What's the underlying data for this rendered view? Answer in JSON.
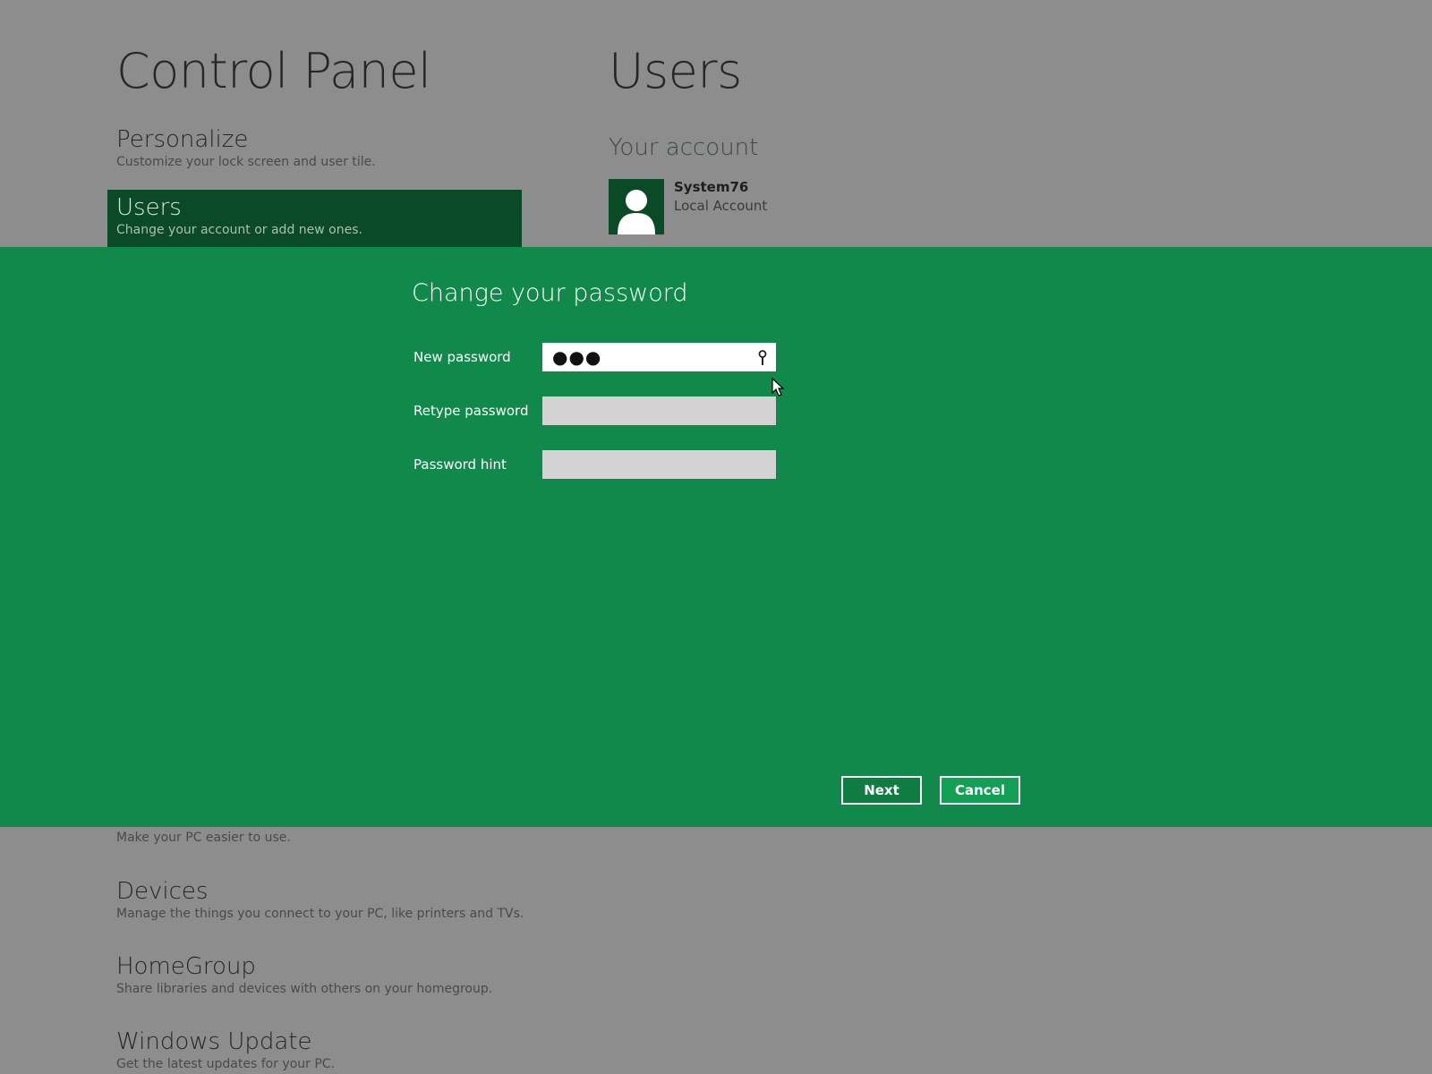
{
  "control_panel": {
    "title": "Control Panel",
    "nav": [
      {
        "label": "Personalize",
        "desc": "Customize your lock screen and user tile."
      },
      {
        "label": "Users",
        "desc": "Change your account or add new ones."
      }
    ],
    "ease_desc": "Make your PC easier to use.",
    "bottom_nav": [
      {
        "label": "Devices",
        "desc": "Manage the things you connect to your PC, like printers and TVs."
      },
      {
        "label": "HomeGroup",
        "desc": "Share libraries and devices with others on your homegroup."
      },
      {
        "label": "Windows Update",
        "desc": "Get the latest updates for your PC."
      }
    ]
  },
  "users_pane": {
    "title": "Users",
    "your_account": "Your account",
    "account_name": "System76",
    "account_type": "Local Account"
  },
  "dialog": {
    "title": "Change your password",
    "new_password_label": "New password",
    "new_password_value": "●●●",
    "retype_label": "Retype password",
    "hint_label": "Password hint",
    "next_label": "Next",
    "cancel_label": "Cancel"
  },
  "colors": {
    "dialog_bg": "#10894a",
    "selected_nav": "#0b4a26",
    "background": "#8d8d8d"
  },
  "icons": [
    "user-avatar-icon",
    "password-reveal-icon",
    "mouse-cursor-icon"
  ]
}
